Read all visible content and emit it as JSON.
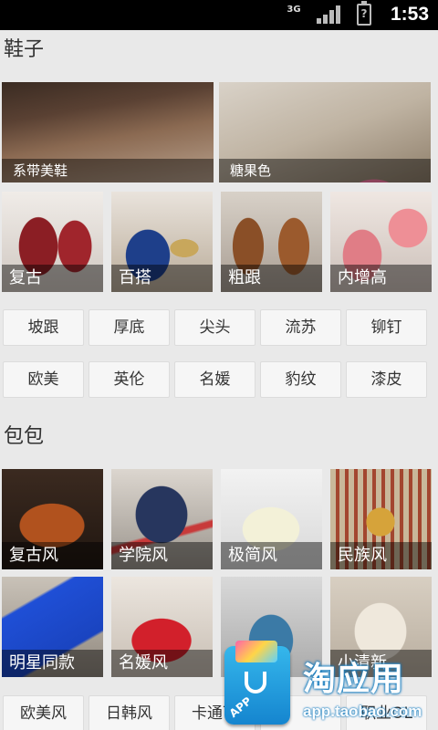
{
  "status_bar": {
    "network": "3G",
    "time": "1:53",
    "battery_glyph": "?"
  },
  "shoes": {
    "title": "鞋子",
    "featured": [
      {
        "label": "系带美鞋",
        "icon": "lace-up-shoe-photo"
      },
      {
        "label": "糖果色",
        "icon": "candy-color-shoe-photo"
      }
    ],
    "tiles": [
      {
        "label": "复古"
      },
      {
        "label": "百搭"
      },
      {
        "label": "粗跟"
      },
      {
        "label": "内增高"
      }
    ],
    "chips_row1": [
      "坡跟",
      "厚底",
      "尖头",
      "流苏",
      "铆钉"
    ],
    "chips_row2": [
      "欧美",
      "英伦",
      "名媛",
      "豹纹",
      "漆皮"
    ]
  },
  "bags": {
    "title": "包包",
    "tiles_row1": [
      {
        "label": "复古风"
      },
      {
        "label": "学院风"
      },
      {
        "label": "极简风"
      },
      {
        "label": "民族风"
      }
    ],
    "tiles_row2": [
      {
        "label": "明星同款"
      },
      {
        "label": "名媛风"
      },
      {
        "label": ""
      },
      {
        "label": "小清新"
      }
    ],
    "chips_row1": [
      "欧美风",
      "日韩风",
      "卡通可",
      "",
      "职业OL"
    ]
  },
  "promo": {
    "title": "淘应用",
    "url": "app.taobao.com",
    "badge": "APP"
  },
  "colors": {
    "background": "#e9e9e9",
    "status_bar": "#000000",
    "caption_overlay": "rgba(0,0,0,0.45)"
  }
}
